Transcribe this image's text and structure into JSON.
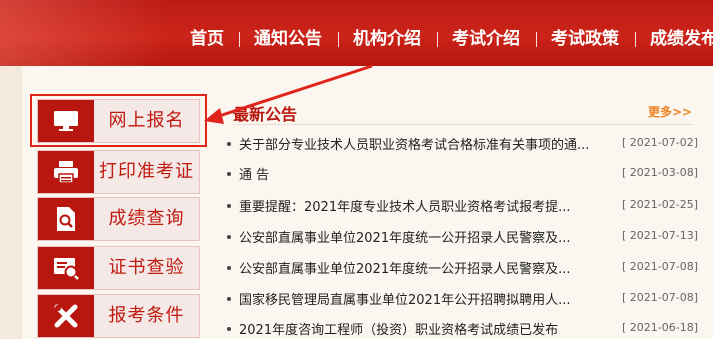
{
  "nav": {
    "items": [
      "首页",
      "通知公告",
      "机构介绍",
      "考试介绍",
      "考试政策",
      "成绩发布"
    ]
  },
  "sidebar": {
    "items": [
      {
        "label": "网上报名",
        "icon": "monitor-icon"
      },
      {
        "label": "打印准考证",
        "icon": "printer-icon"
      },
      {
        "label": "成绩查询",
        "icon": "document-search-icon"
      },
      {
        "label": "证书查验",
        "icon": "certificate-icon"
      },
      {
        "label": "报考条件",
        "icon": "tools-icon"
      }
    ]
  },
  "news": {
    "title": "最新公告",
    "more": "更多>>",
    "items": [
      {
        "text": "关于部分专业技术人员职业资格考试合格标准有关事项的通...",
        "date": "[ 2021-07-02]"
      },
      {
        "text": "通 告",
        "date": "[ 2021-03-08]"
      },
      {
        "text": "重要提醒：2021年度专业技术人员职业资格考试报考提...",
        "date": "[ 2021-02-25]"
      },
      {
        "text": "公安部直属事业单位2021年度统一公开招录人民警察及...",
        "date": "[ 2021-07-13]"
      },
      {
        "text": "公安部直属事业单位2021年度统一公开招录人民警察及...",
        "date": "[ 2021-07-08]"
      },
      {
        "text": "国家移民管理局直属事业单位2021年公开招聘拟聘用人...",
        "date": "[ 2021-07-08]"
      },
      {
        "text": "2021年度咨询工程师（投资）职业资格考试成绩已发布",
        "date": "[ 2021-06-18]"
      }
    ]
  },
  "colors": {
    "brand_red": "#b8160e",
    "more_orange": "#f08322",
    "highlight_red": "#e0231b"
  }
}
